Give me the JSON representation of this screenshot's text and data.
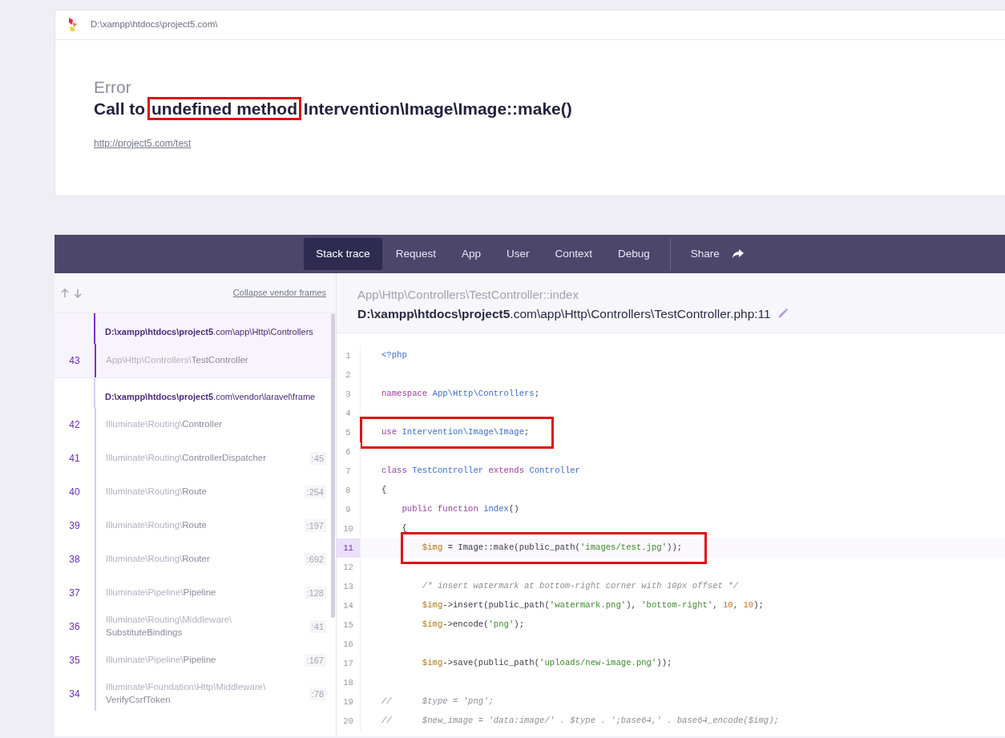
{
  "header": {
    "path": "D:\\xampp\\htdocs\\project5.com\\"
  },
  "error": {
    "kind_label": "Error",
    "title_parts": [
      {
        "text": "Call to ",
        "highlighted": false
      },
      {
        "text": "undefined method",
        "highlighted": true
      },
      {
        "text": " Intervention\\Image\\Image::make()",
        "highlighted": false
      }
    ],
    "url": "http://project5.com/test"
  },
  "tabs": [
    {
      "label": "Stack trace",
      "selected": true
    },
    {
      "label": "Request",
      "selected": false
    },
    {
      "label": "App",
      "selected": false
    },
    {
      "label": "User",
      "selected": false
    },
    {
      "label": "Context",
      "selected": false
    },
    {
      "label": "Debug",
      "selected": false
    }
  ],
  "share": {
    "label": "Share"
  },
  "sidebar": {
    "collapse_link": "Collapse vendor frames",
    "groups": [
      {
        "file": "**D:\\xampp\\htdocs\\project5**.com\\app\\Http\\Controllers",
        "frames": [
          {
            "number": "43",
            "namespace": "App\\Http\\Controllers\\",
            "class": "TestController",
            "selected": true
          }
        ]
      },
      {
        "file": "**D:\\xampp\\htdocs\\project5**.com\\vendor\\laravel\\frame",
        "frames": [
          {
            "number": "42",
            "namespace": "Illuminate\\Routing\\",
            "class": "Controller",
            "selected": false
          },
          {
            "number": "41",
            "namespace": "Illuminate\\Routing\\",
            "class": "ControllerDispatcher",
            "line": ":45",
            "selected": false
          },
          {
            "number": "40",
            "namespace": "Illuminate\\Routing\\",
            "class": "Route",
            "line": ":254",
            "selected": false
          },
          {
            "number": "39",
            "namespace": "Illuminate\\Routing\\",
            "class": "Route",
            "line": ":197",
            "selected": false
          },
          {
            "number": "38",
            "namespace": "Illuminate\\Routing\\",
            "class": "Router",
            "line": ":692",
            "selected": false
          },
          {
            "number": "37",
            "namespace": "Illuminate\\Pipeline\\",
            "class": "Pipeline",
            "line": ":128",
            "selected": false
          },
          {
            "number": "36",
            "namespace": "Illuminate\\Routing\\Middleware\\",
            "class": "SubstituteBindings",
            "line": ":41",
            "selected": false
          },
          {
            "number": "35",
            "namespace": "Illuminate\\Pipeline\\",
            "class": "Pipeline",
            "line": ":167",
            "selected": false
          },
          {
            "number": "34",
            "namespace": "Illuminate\\Foundation\\Http\\Middleware\\",
            "class": "VerifyCsrfToken",
            "line": ":78",
            "selected": false
          }
        ]
      }
    ]
  },
  "frame_detail": {
    "method": "App\\Http\\Controllers\\TestController::index",
    "file": "**D:\\xampp\\htdocs\\project5**.com\\app\\Http\\Controllers\\TestController.php:11",
    "code_lines": [
      {
        "number": "1",
        "selected": false,
        "highlighted": false,
        "tokens": [
          {
            "kind": "class",
            "text": "<?php"
          }
        ]
      },
      {
        "number": "2",
        "selected": false,
        "highlighted": false
      },
      {
        "number": "3",
        "selected": false,
        "highlighted": false,
        "tokens": [
          {
            "kind": "keyword",
            "text": "namespace "
          },
          {
            "kind": "class",
            "text": "App\\Http\\Controllers"
          },
          {
            "kind": "plain",
            "text": ";"
          }
        ]
      },
      {
        "number": "4",
        "selected": false,
        "highlighted": false
      },
      {
        "number": "5",
        "selected": false,
        "highlighted": true,
        "tokens": [
          {
            "kind": "keyword",
            "text": "use "
          },
          {
            "kind": "class",
            "text": "Intervention\\Image\\Image"
          },
          {
            "kind": "plain",
            "text": ";"
          }
        ]
      },
      {
        "number": "6",
        "selected": false,
        "highlighted": false
      },
      {
        "number": "7",
        "selected": false,
        "highlighted": false,
        "tokens": [
          {
            "kind": "keyword",
            "text": "class "
          },
          {
            "kind": "class",
            "text": "TestController "
          },
          {
            "kind": "keyword",
            "text": "extends "
          },
          {
            "kind": "class",
            "text": "Controller"
          }
        ]
      },
      {
        "number": "8",
        "selected": false,
        "highlighted": false,
        "tokens": [
          {
            "kind": "plain",
            "text": "{"
          }
        ]
      },
      {
        "number": "9",
        "selected": false,
        "highlighted": false,
        "tokens": [
          {
            "kind": "keyword",
            "text": "    public function "
          },
          {
            "kind": "class",
            "text": "index"
          },
          {
            "kind": "plain",
            "text": "()"
          }
        ]
      },
      {
        "number": "10",
        "selected": false,
        "highlighted": false,
        "tokens": [
          {
            "kind": "plain",
            "text": "    {"
          }
        ]
      },
      {
        "number": "11",
        "selected": true,
        "highlighted": true,
        "tokens": [
          {
            "kind": "variable",
            "text": "        $img"
          },
          {
            "kind": "plain",
            "text": " = Image::make(public_path("
          },
          {
            "kind": "string",
            "text": "'images/test.jpg'"
          },
          {
            "kind": "plain",
            "text": "));"
          }
        ]
      },
      {
        "number": "12",
        "selected": false,
        "highlighted": false
      },
      {
        "number": "13",
        "selected": false,
        "highlighted": false,
        "tokens": [
          {
            "kind": "comment",
            "text": "        /* insert watermark at bottom-right corner with 10px offset */"
          }
        ]
      },
      {
        "number": "14",
        "selected": false,
        "highlighted": false,
        "tokens": [
          {
            "kind": "variable",
            "text": "        $img"
          },
          {
            "kind": "plain",
            "text": "->insert(public_path("
          },
          {
            "kind": "string",
            "text": "'watermark.png'"
          },
          {
            "kind": "plain",
            "text": "), "
          },
          {
            "kind": "string",
            "text": "'bottom-right'"
          },
          {
            "kind": "plain",
            "text": ", "
          },
          {
            "kind": "number",
            "text": "10"
          },
          {
            "kind": "plain",
            "text": ", "
          },
          {
            "kind": "number",
            "text": "10"
          },
          {
            "kind": "plain",
            "text": ");"
          }
        ]
      },
      {
        "number": "15",
        "selected": false,
        "highlighted": false,
        "tokens": [
          {
            "kind": "variable",
            "text": "        $img"
          },
          {
            "kind": "plain",
            "text": "->encode("
          },
          {
            "kind": "string",
            "text": "'png'"
          },
          {
            "kind": "plain",
            "text": ");"
          }
        ]
      },
      {
        "number": "16",
        "selected": false,
        "highlighted": false
      },
      {
        "number": "17",
        "selected": false,
        "highlighted": false,
        "tokens": [
          {
            "kind": "variable",
            "text": "        $img"
          },
          {
            "kind": "plain",
            "text": "->save(public_path("
          },
          {
            "kind": "string",
            "text": "'uploads/new-image.png'"
          },
          {
            "kind": "plain",
            "text": "));"
          }
        ]
      },
      {
        "number": "18",
        "selected": false,
        "highlighted": false
      },
      {
        "number": "19",
        "selected": false,
        "highlighted": false,
        "tokens": [
          {
            "kind": "comment",
            "text": "//      $type = 'png';"
          }
        ]
      },
      {
        "number": "20",
        "selected": false,
        "highlighted": false,
        "tokens": [
          {
            "kind": "comment",
            "text": "//      $new_image = 'data:image/' . $type . ';base64,' . base64_encode($img);"
          }
        ]
      }
    ]
  }
}
